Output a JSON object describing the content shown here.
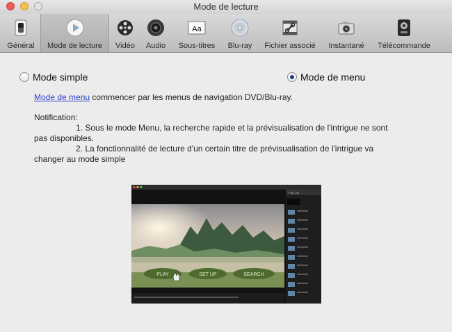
{
  "window": {
    "title": "Mode de lecture"
  },
  "toolbar": {
    "items": [
      {
        "label": "Général",
        "icon": "switch-icon"
      },
      {
        "label": "Mode de lecture",
        "icon": "play-icon",
        "selected": true
      },
      {
        "label": "Vidéo",
        "icon": "film-reel-icon"
      },
      {
        "label": "Audio",
        "icon": "speaker-icon"
      },
      {
        "label": "Sous-titres",
        "icon": "subtitle-icon"
      },
      {
        "label": "Blu-ray",
        "icon": "disc-icon"
      },
      {
        "label": "Fichier associé",
        "icon": "file-link-icon"
      },
      {
        "label": "Instantané",
        "icon": "camera-icon"
      },
      {
        "label": "Télécommande",
        "icon": "remote-icon"
      }
    ]
  },
  "modes": {
    "simple_label": "Mode simple",
    "menu_label": "Mode de menu",
    "selected": "Mode de menu"
  },
  "description": {
    "link_text": "Mode de menu",
    "text": " commencer par les menus de navigation DVD/Blu-ray."
  },
  "notification": {
    "title": "Notification:",
    "item1_a": "1. Sous le mode Menu, la recherche rapide et la prévisualisation de l'intrigue ne sont",
    "item1_b": "pas disponibles.",
    "item2_a": "2. La fonctionnalité de lecture d'un certain titre de prévisualisation de l'intrigue va",
    "item2_b": "changer au mode simple"
  },
  "preview": {
    "play_label": "PLAY",
    "setup_label": "SET UP",
    "search_label": "SEARCH",
    "sidebar_title": "Play List"
  },
  "colors": {
    "link": "#2a3fc9",
    "radio_selected": "#1f3c6e"
  }
}
